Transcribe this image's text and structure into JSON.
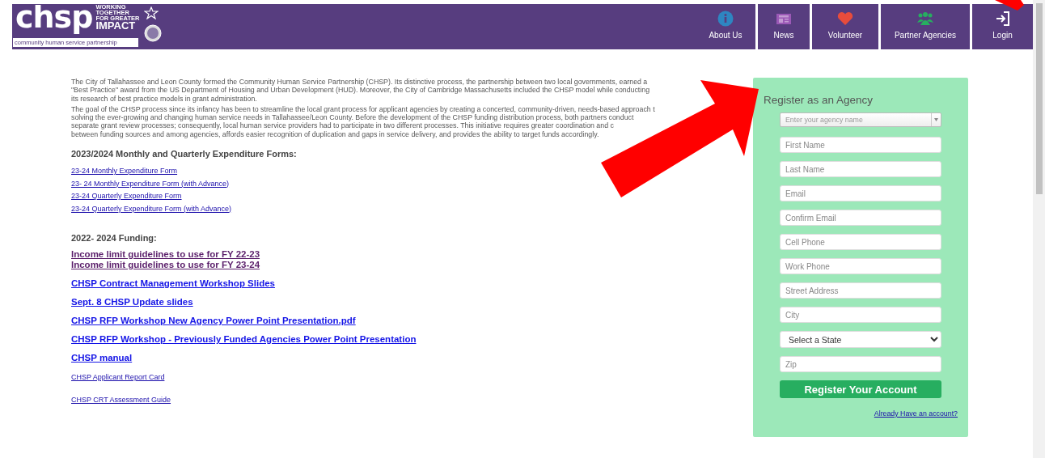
{
  "header": {
    "logo": {
      "wordmark": "chsp",
      "tagline": [
        "WORKING",
        "TOGETHER",
        "FOR GREATER",
        "IMPACT"
      ],
      "subtitle": "community human service partnership"
    },
    "nav": [
      {
        "label": "About Us"
      },
      {
        "label": "News"
      },
      {
        "label": "Volunteer"
      },
      {
        "label": "Partner Agencies"
      },
      {
        "label": "Login"
      }
    ]
  },
  "intro": [
    {
      "lines": [
        "The City of Tallahassee and Leon County formed the Community Human Service Partnership (CHSP). Its distinctive process, the partnership between two local governments, earned a",
        "\"Best Practice\" award from the US Department of Housing and Urban Development (HUD).  Moreover, the City of Cambridge Massachusetts included the CHSP model while conducting",
        "its research of best practice models in grant administration."
      ]
    },
    {
      "lines": [
        "The goal of the CHSP process since its infancy has been to streamline the local grant process for applicant agencies by creating a concerted, community-driven, needs-based approach t",
        "solving the ever-growing and changing human service needs in Tallahassee/Leon County. Before the development of the CHSP funding distribution process, both partners conduct",
        "separate grant review processes; consequently, local human service providers had to participate in two different processes. This initiative requires greater coordination and c",
        "between funding sources and among agencies, affords easier recognition of duplication and gaps in service delivery, and provides the ability to target funds accordingly."
      ]
    }
  ],
  "blocks": [
    {
      "kind": "heading",
      "text": "2023/2024 Monthly and Quarterly Expenditure Forms:"
    },
    {
      "kind": "small-links",
      "items": [
        {
          "text": "23-24 Monthly Expenditure Form",
          "visited": false
        },
        {
          "text": "23- 24 Monthly Expenditure Form (with Advance)",
          "visited": false
        },
        {
          "text": "23-24 Quarterly Expenditure Form",
          "visited": false
        },
        {
          "text": "23-24 Quarterly Expenditure Form (with Advance)",
          "visited": false
        }
      ]
    },
    {
      "kind": "heading",
      "text": "2022- 2024 Funding:"
    },
    {
      "kind": "large-links",
      "items": [
        {
          "text": "Income limit guidelines to use for FY 22-23",
          "visited": true
        },
        {
          "text": "Income limit guidelines to use for FY 23-24",
          "visited": true
        }
      ]
    },
    {
      "kind": "large-links",
      "items": [
        {
          "text": "CHSP Contract Management Workshop Slides",
          "visited": false
        }
      ]
    },
    {
      "kind": "large-links",
      "items": [
        {
          "text": "Sept. 8 CHSP Update slides",
          "visited": false
        }
      ]
    },
    {
      "kind": "large-links",
      "items": [
        {
          "text": "CHSP RFP Workshop New Agency Power Point Presentation.pdf",
          "visited": false
        }
      ]
    },
    {
      "kind": "large-links",
      "items": [
        {
          "text": "CHSP RFP Workshop - Previously Funded Agencies Power Point Presentation",
          "visited": false
        }
      ]
    },
    {
      "kind": "large-links",
      "items": [
        {
          "text": "CHSP manual",
          "visited": false
        }
      ]
    },
    {
      "kind": "small-links",
      "items": [
        {
          "text": "CHSP Applicant Report Card",
          "visited": false
        }
      ]
    },
    {
      "kind": "small-links",
      "items": [
        {
          "text": "CHSP CRT Assessment Guide",
          "visited": false
        }
      ]
    }
  ],
  "register": {
    "title": "Register as an Agency",
    "fields": [
      {
        "kind": "combo",
        "placeholder": "Enter your agency name"
      },
      {
        "kind": "text",
        "placeholder": "First Name"
      },
      {
        "kind": "text",
        "placeholder": "Last Name"
      },
      {
        "kind": "text",
        "placeholder": "Email"
      },
      {
        "kind": "text",
        "placeholder": "Confirm Email"
      },
      {
        "kind": "text",
        "placeholder": "Cell Phone"
      },
      {
        "kind": "text",
        "placeholder": "Work Phone"
      },
      {
        "kind": "text",
        "placeholder": "Street Address"
      },
      {
        "kind": "text",
        "placeholder": "City"
      },
      {
        "kind": "select",
        "value": "Select a State"
      },
      {
        "kind": "text",
        "placeholder": "Zip"
      }
    ],
    "button": "Register Your Account",
    "link": "Already Have an account?"
  }
}
